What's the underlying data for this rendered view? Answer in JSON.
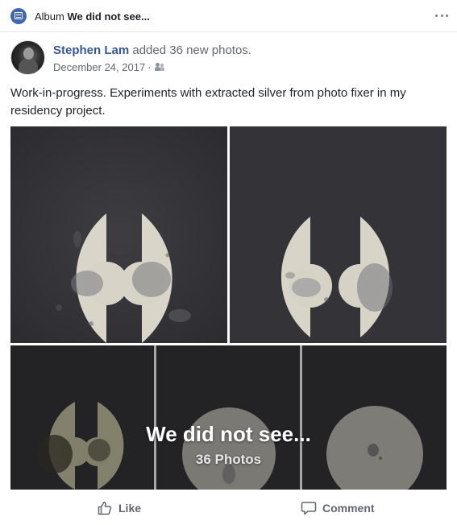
{
  "header": {
    "prefix": "Album",
    "album_name": "We did not see...",
    "icon": "album-icon",
    "more_icon": "more-dots-icon"
  },
  "post": {
    "author": "Stephen Lam",
    "action_text": "added 36 new photos.",
    "date": "December 24, 2017",
    "separator": "·",
    "audience_icon": "friends-icon",
    "text": "Work-in-progress. Experiments with extracted silver from photo fixer in my residency project."
  },
  "album_overlay": {
    "title": "We did not see...",
    "count_label": "36 Photos"
  },
  "actions": {
    "like_label": "Like",
    "comment_label": "Comment"
  },
  "colors": {
    "link_blue": "#365899",
    "meta_gray": "#616770",
    "icon_blue": "#4267b2",
    "photo_background": "#353437",
    "paper": "#d9d6cc"
  }
}
